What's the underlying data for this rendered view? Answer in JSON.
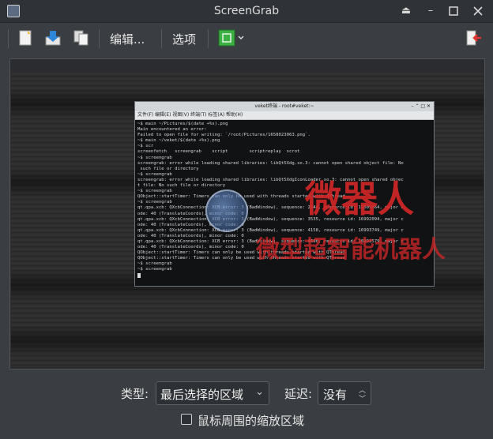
{
  "window": {
    "title": "ScreenGrab"
  },
  "toolbar": {
    "edit_label": "编辑...",
    "options_label": "选项"
  },
  "terminal": {
    "title": "veket终端 - root#veket:~",
    "menu": "文件(F)  编辑(E)  视图(V)  终端(T)  标签(A)  帮助(H)",
    "lines": [
      "~$ main ~/Pictures/$(date +%s).png",
      "Main encountered an error:",
      "Failed to open file for writing: `/root/Pictures/1658023063.png`.",
      "~$ main ~/veket/$(date +%s).png",
      "~$ scr",
      "screenfetch   screengrab    script        scriptreplay  scrot",
      "~$ screengrab",
      "screengrab: error while loading shared libraries: libQt5Xdg.so.3: cannot open shared object file: No",
      " such file or directory",
      "~$ screengrab",
      "screengrab: error while loading shared libraries: libQt5XdgIconLoader.so.3: cannot open shared objec",
      "t file: No such file or directory",
      "~$ screengrab",
      "QObject::startTimer: Timers can only be used with threads started with QThread",
      "~$ screengrab",
      "qt.qpa.xcb: QXcbConnection: XCB error: 3 (BadWindow), sequence: 2244, resource id: 16609864, major c",
      "ode: 40 (TranslateCoords), minor code: 0",
      "qt.qpa.xcb: QXcbConnection: XCB error: 3 (BadWindow), sequence: 3535, resource id: 16992094, major c",
      "ode: 40 (TranslateCoords), minor code: 0",
      "qt.qpa.xcb: QXcbConnection: XCB error: 3 (BadWindow), sequence: 4158, resource id: 16993749, major c",
      "ode: 40 (TranslateCoords), minor code: 0",
      "qt.qpa.xcb: QXcbConnection: XCB error: 3 (BadWindow), sequence: 4600, resource id: 16993579, major c",
      "ode: 40 (TranslateCoords), minor code: 0",
      "QObject::startTimer: Timers can only be used with threads started with QThread",
      "QObject::startTimer: Timers can only be used with threads started with QThread",
      "~$ screengrab",
      "~$ screengrab"
    ]
  },
  "watermark": {
    "text1": "微器人",
    "text2": "微型超智能机器人"
  },
  "bottom": {
    "type_label": "类型:",
    "type_value": "最后选择的区域",
    "delay_label": "延迟:",
    "delay_value": "没有",
    "zoom_checkbox_label": "鼠标周围的缩放区域",
    "zoom_checked": false
  },
  "colors": {
    "accent": "#d42727",
    "background": "#3a3d41"
  }
}
